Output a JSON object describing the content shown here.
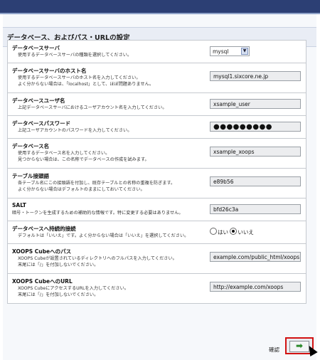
{
  "header": {
    "title": "データベース、およびパス・URLの設定"
  },
  "rows": [
    {
      "label": "データベースサーバ",
      "desc": [
        "使用するデータベースサーバの種類を選択してください。"
      ],
      "control": {
        "type": "select",
        "value": "mysql"
      }
    },
    {
      "label": "データベースサーバのホスト名",
      "desc": [
        "使用するデータベースサーバのホスト名を入力してください。",
        "よく分からない場合は、「localhost」として、ほぼ問題ありません。"
      ],
      "control": {
        "type": "text",
        "value": "mysql1.sixcore.ne.jp"
      }
    },
    {
      "label": "データベースユーザ名",
      "desc": [
        "上記データベースサーバにおけるユーザアカウント名を入力してください。"
      ],
      "control": {
        "type": "text",
        "value": "xsample_user"
      }
    },
    {
      "label": "データベースパスワード",
      "desc": [
        "上記ユーザアカウントのパスワードを入力してください。"
      ],
      "control": {
        "type": "password",
        "value": "●●●●●●●●●"
      }
    },
    {
      "label": "データベース名",
      "desc": [
        "使用するデータベース名を入力してください。",
        "見つからない場合は、この名称でデータベースの作成を試みます。"
      ],
      "control": {
        "type": "text",
        "value": "xsample_xoops"
      }
    },
    {
      "label": "テーブル接頭語",
      "desc": [
        "各テーブル名にこの接頭語を付加し、既存テーブルとの名称の重複を防ぎます。",
        "よく分からない場合はデフォルトのままにしておいてください。"
      ],
      "control": {
        "type": "text",
        "value": "e89b56"
      }
    },
    {
      "label": "SALT",
      "desc": [
        "暗号・トークンを生成するための補助的な情報です。特に変更する必要はありません。"
      ],
      "control": {
        "type": "text",
        "value": "bfd26c3a"
      }
    },
    {
      "label": "データベースへ持続的接続",
      "desc": [
        "デフォルトは「いいえ」です。よく分からない場合は「いいえ」を選択してください。"
      ],
      "control": {
        "type": "radio",
        "options": [
          "はい",
          "いいえ"
        ],
        "selected": "いいえ"
      }
    },
    {
      "label": "XOOPS Cubeへのパス",
      "desc": [
        "XOOPS Cubeが設置されているディレクトリへのフルパスを入力してください。",
        "末尾には「/」を付加しないでください。"
      ],
      "control": {
        "type": "text",
        "value": "example.com/public_html/xoops"
      }
    },
    {
      "label": "XOOPS CubeへのURL",
      "desc": [
        "XOOPS CubeにアクセスするURLを入力してください。",
        "末尾には「/」を付加しないでください。"
      ],
      "control": {
        "type": "text",
        "value": "http://example.com/xoops"
      }
    }
  ],
  "footer": {
    "next_label": "確認",
    "next_icon": "right-arrow-icon",
    "next_glyph": "➡"
  }
}
